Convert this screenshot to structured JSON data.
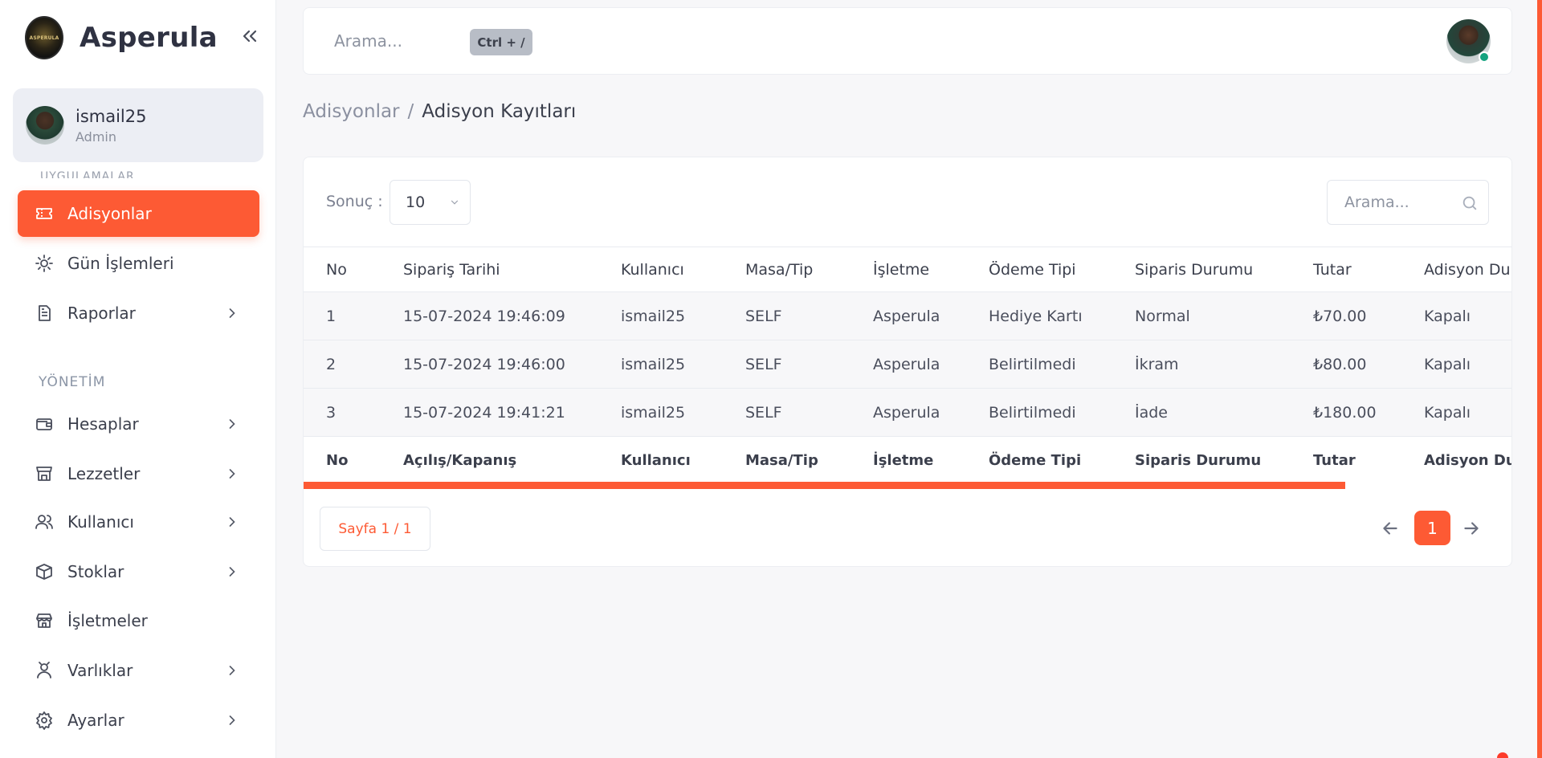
{
  "brand": {
    "name": "Asperula",
    "logo_text": "ASPERULA"
  },
  "user": {
    "name": "ismail25",
    "role": "Admin"
  },
  "sidebar": {
    "items": [
      {
        "label": "Adisyonlar",
        "icon": "ticket-icon",
        "active": true
      },
      {
        "label": "Gün İşlemleri",
        "icon": "sun-gear-icon"
      },
      {
        "label": "Raporlar",
        "icon": "report-icon"
      }
    ],
    "section_title": "YÖNETİM",
    "admin_items": [
      {
        "label": "Hesaplar",
        "icon": "wallet-icon"
      },
      {
        "label": "Lezzetler",
        "icon": "store-icon"
      },
      {
        "label": "Kullanıcı",
        "icon": "users-icon"
      },
      {
        "label": "Stoklar",
        "icon": "box-icon"
      },
      {
        "label": "İşletmeler",
        "icon": "shop-icon"
      },
      {
        "label": "Varlıklar",
        "icon": "user-assets-icon"
      },
      {
        "label": "Ayarlar",
        "icon": "gear-icon"
      }
    ]
  },
  "topbar": {
    "search_placeholder": "Arama...",
    "shortcut": "Ctrl + /"
  },
  "breadcrumb": {
    "parent": "Adisyonlar",
    "separator": "/",
    "current": "Adisyon Kayıtları"
  },
  "table": {
    "result_label": "Sonuç :",
    "page_size": "10",
    "search_placeholder": "Arama...",
    "columns": [
      "No",
      "Sipariş Tarihi",
      "Kullanıcı",
      "Masa/Tip",
      "İşletme",
      "Ödeme Tipi",
      "Siparis Durumu",
      "Tutar",
      "Adisyon Du"
    ],
    "rows": [
      [
        "1",
        "15-07-2024 19:46:09",
        "ismail25",
        "SELF",
        "Asperula",
        "Hediye Kartı",
        "Normal",
        "₺70.00",
        "Kapalı"
      ],
      [
        "2",
        "15-07-2024 19:46:00",
        "ismail25",
        "SELF",
        "Asperula",
        "Belirtilmedi",
        "İkram",
        "₺80.00",
        "Kapalı"
      ],
      [
        "3",
        "15-07-2024 19:41:21",
        "ismail25",
        "SELF",
        "Asperula",
        "Belirtilmedi",
        "İade",
        "₺180.00",
        "Kapalı"
      ]
    ],
    "footer_columns": [
      "No",
      "Açılış/Kapanış",
      "Kullanıcı",
      "Masa/Tip",
      "İşletme",
      "Ödeme Tipi",
      "Siparis Durumu",
      "Tutar",
      "Adisyon Du"
    ]
  },
  "pagination": {
    "info": "Sayfa 1 / 1",
    "current": "1"
  },
  "colors": {
    "accent": "#fd5a34",
    "online": "#14a37f",
    "sidebar_bg": "#ffffff",
    "page_bg": "#f7f7f9"
  }
}
